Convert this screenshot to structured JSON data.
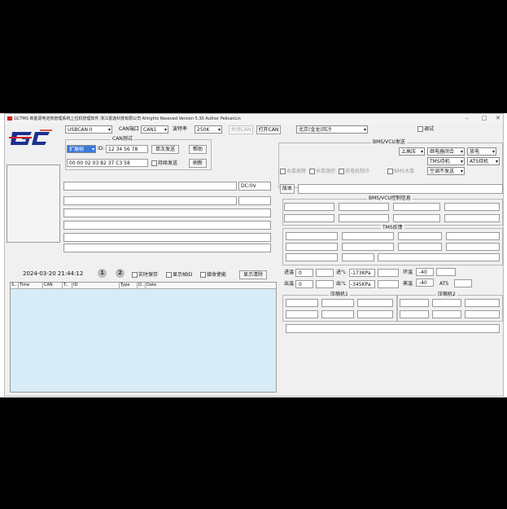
{
  "window": {
    "title_text": "GCTMS 新能源电池热管理系统上位机管理软件  浙江嘉逸科技有限公司   Allrights Reseved   Version 5.30   Author PelicanLin",
    "min_glyph": "–",
    "max_glyph": "□",
    "close_glyph": "✕"
  },
  "toolbar": {
    "device_value": "USBCAN II",
    "can_port_label": "CAN端口",
    "can_port_value": "CAN1",
    "baud_label": "波特率",
    "baud_value": "250K",
    "close_btn": "关闭CAN",
    "open_btn": "打开CAN",
    "model_value": "北京(金龙)风冷",
    "debug_label": "调试"
  },
  "can_test": {
    "title": "CAN测试",
    "frame_type": "扩展帧",
    "id_label": "ID:",
    "id_value": "12 34 56 78",
    "single_send": "单次发送",
    "help": "帮助",
    "data_value": "00 00 02 03 82 37 C3 58",
    "continuous_send": "持续发送",
    "refresh": "刷新"
  },
  "dc_label": "DC:0V",
  "status": {
    "datetime": "2024-03-20  21:44:12",
    "circle1": "1",
    "circle2": "2",
    "realtime_save": "实时保存",
    "show_filter": "显示帧ID",
    "receive_enable": "接收使能",
    "clear_display": "显示清除"
  },
  "log_table": {
    "columns": [
      "S..",
      "Time",
      "CAN",
      "T..",
      "ID",
      "Type",
      "D..",
      "Data"
    ]
  },
  "bms_vcu": {
    "title": "BMS/VCU发送",
    "sel_power": "上高压",
    "sel_relay": "继电器闭合",
    "sel_charge": "放电",
    "sel_tms": "TMS待机",
    "sel_ats": "ATS待机",
    "sel_ac": "空调不发送",
    "cb_pump_fault": "水泵故障",
    "cb_pump_ctrl": "水泵强控",
    "cb_charger": "充电机制冷",
    "cb_bms_pump": "BMS水泵",
    "version_btn": "版本"
  },
  "bms_ctrl_title": "BMS/VCU控制信息",
  "tms_title": "TMS反馈",
  "temps": {
    "in_water_label": "进温",
    "in_water_value": "0",
    "out_water_label": "出温",
    "out_water_value": "0",
    "in_pressure_label": "进°L",
    "in_pressure_value": "-173KPa",
    "out_pressure_label": "出°L",
    "out_pressure_value": "-345KPa",
    "ambient_label": "环温",
    "ambient_value": "-40",
    "evap_label": "蒸温",
    "evap_value": "-40",
    "ats_label": "ATS"
  },
  "compressor1_title": "压缩机1",
  "compressor2_title": "压缩机2",
  "logo_text": "GC"
}
